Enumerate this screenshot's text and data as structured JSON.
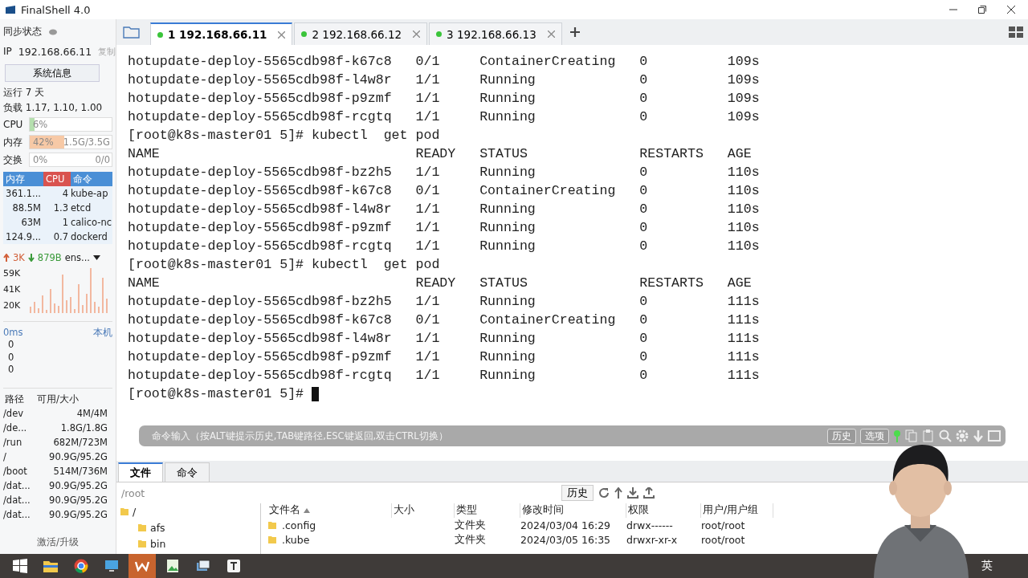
{
  "window": {
    "title": "FinalShell 4.0"
  },
  "sidebar": {
    "sync_status": "同步状态",
    "ip_label": "IP",
    "ip": "192.168.66.11",
    "copy": "复制",
    "sysinfo_button": "系统信息",
    "uptime": "运行 7 天",
    "load": "负载 1.17, 1.10, 1.00",
    "meters": [
      {
        "label": "CPU",
        "value": "6%",
        "level": 0.06,
        "color": "#b5dfae"
      },
      {
        "label": "内存",
        "value": "42%",
        "detail": "1.5G/3.5G",
        "level": 0.42,
        "color": "#f7c9a6"
      },
      {
        "label": "交换",
        "value": "0%",
        "detail": "0/0"
      }
    ],
    "process_columns": [
      {
        "label": "内存",
        "selected": false
      },
      {
        "label": "CPU",
        "selected": true
      },
      {
        "label": "命令",
        "selected": false
      }
    ],
    "processes": [
      [
        "361.1...",
        "4",
        "kube-ap"
      ],
      [
        "88.5M",
        "1.3",
        "etcd"
      ],
      [
        "63M",
        "1",
        "calico-nc"
      ],
      [
        "124.9...",
        "0.7",
        "dockerd"
      ]
    ],
    "network": {
      "up": "3K",
      "down": "879B",
      "interface": "ens...",
      "y_labels": [
        "59K",
        "41K",
        "20K"
      ]
    },
    "ping": {
      "latency": "0ms",
      "host": "本机",
      "values": [
        "0",
        "0",
        "0"
      ]
    },
    "disk_columns": [
      "路径",
      "可用/大小"
    ],
    "disks": [
      [
        "/dev",
        "4M/4M"
      ],
      [
        "/de...",
        "1.8G/1.8G"
      ],
      [
        "/run",
        "682M/723M"
      ],
      [
        "/",
        "90.9G/95.2G"
      ],
      [
        "/boot",
        "514M/736M"
      ],
      [
        "/dat...",
        "90.9G/95.2G"
      ],
      [
        "/dat...",
        "90.9G/95.2G"
      ],
      [
        "/dat...",
        "90.9G/95.2G"
      ]
    ],
    "activate": "激活/升级"
  },
  "tabs": [
    {
      "number": "1",
      "host": "192.168.66.11",
      "selected": true
    },
    {
      "number": "2",
      "host": "192.168.66.12",
      "selected": false
    },
    {
      "number": "3",
      "host": "192.168.66.13",
      "selected": false
    }
  ],
  "terminal": {
    "lines": [
      {
        "kind": "row",
        "cells": [
          "hotupdate-deploy-5565cdb98f-k67c8",
          "0/1",
          "ContainerCreating",
          "0",
          "109s"
        ]
      },
      {
        "kind": "row",
        "cells": [
          "hotupdate-deploy-5565cdb98f-l4w8r",
          "1/1",
          "Running",
          "0",
          "109s"
        ]
      },
      {
        "kind": "row",
        "cells": [
          "hotupdate-deploy-5565cdb98f-p9zmf",
          "1/1",
          "Running",
          "0",
          "109s"
        ]
      },
      {
        "kind": "row",
        "cells": [
          "hotupdate-deploy-5565cdb98f-rcgtq",
          "1/1",
          "Running",
          "0",
          "109s"
        ]
      },
      {
        "kind": "prompt",
        "text": "[root@k8s-master01 5]# kubectl  get pod"
      },
      {
        "kind": "row",
        "cells": [
          "NAME",
          "READY",
          "STATUS",
          "RESTARTS",
          "AGE"
        ]
      },
      {
        "kind": "row",
        "cells": [
          "hotupdate-deploy-5565cdb98f-bz2h5",
          "1/1",
          "Running",
          "0",
          "110s"
        ]
      },
      {
        "kind": "row",
        "cells": [
          "hotupdate-deploy-5565cdb98f-k67c8",
          "0/1",
          "ContainerCreating",
          "0",
          "110s"
        ]
      },
      {
        "kind": "row",
        "cells": [
          "hotupdate-deploy-5565cdb98f-l4w8r",
          "1/1",
          "Running",
          "0",
          "110s"
        ]
      },
      {
        "kind": "row",
        "cells": [
          "hotupdate-deploy-5565cdb98f-p9zmf",
          "1/1",
          "Running",
          "0",
          "110s"
        ]
      },
      {
        "kind": "row",
        "cells": [
          "hotupdate-deploy-5565cdb98f-rcgtq",
          "1/1",
          "Running",
          "0",
          "110s"
        ]
      },
      {
        "kind": "prompt",
        "text": "[root@k8s-master01 5]# kubectl  get pod"
      },
      {
        "kind": "row",
        "cells": [
          "NAME",
          "READY",
          "STATUS",
          "RESTARTS",
          "AGE"
        ]
      },
      {
        "kind": "row",
        "cells": [
          "hotupdate-deploy-5565cdb98f-bz2h5",
          "1/1",
          "Running",
          "0",
          "111s"
        ]
      },
      {
        "kind": "row",
        "cells": [
          "hotupdate-deploy-5565cdb98f-k67c8",
          "0/1",
          "ContainerCreating",
          "0",
          "111s"
        ]
      },
      {
        "kind": "row",
        "cells": [
          "hotupdate-deploy-5565cdb98f-l4w8r",
          "1/1",
          "Running",
          "0",
          "111s"
        ]
      },
      {
        "kind": "row",
        "cells": [
          "hotupdate-deploy-5565cdb98f-p9zmf",
          "1/1",
          "Running",
          "0",
          "111s"
        ]
      },
      {
        "kind": "row",
        "cells": [
          "hotupdate-deploy-5565cdb98f-rcgtq",
          "1/1",
          "Running",
          "0",
          "111s"
        ]
      },
      {
        "kind": "prompt",
        "text": "[root@k8s-master01 5]# ",
        "cursor": true
      }
    ]
  },
  "command_bar": {
    "placeholder": "命令输入（按ALT键提示历史,TAB键路径,ESC键返回,双击CTRL切换）",
    "buttons": [
      "历史",
      "选项"
    ]
  },
  "bottom_panel": {
    "tabs": [
      {
        "label": "文件",
        "selected": true
      },
      {
        "label": "命令",
        "selected": false
      }
    ],
    "path": "/root",
    "history_button": "历史",
    "tree": {
      "label": "/",
      "children": [
        {
          "label": "afs"
        },
        {
          "label": "bin"
        }
      ]
    },
    "columns": [
      "文件名",
      "大小",
      "类型",
      "修改时间",
      "权限",
      "用户/用户组"
    ],
    "files": [
      {
        "name": ".config",
        "type": "文件夹",
        "modified": "2024/03/04 16:29",
        "permissions": "drwx------",
        "owner": "root/root"
      },
      {
        "name": ".kube",
        "type": "文件夹",
        "modified": "2024/03/05 16:35",
        "permissions": "drwxr-xr-x",
        "owner": "root/root"
      }
    ]
  },
  "taskbar": {
    "language": "英"
  }
}
